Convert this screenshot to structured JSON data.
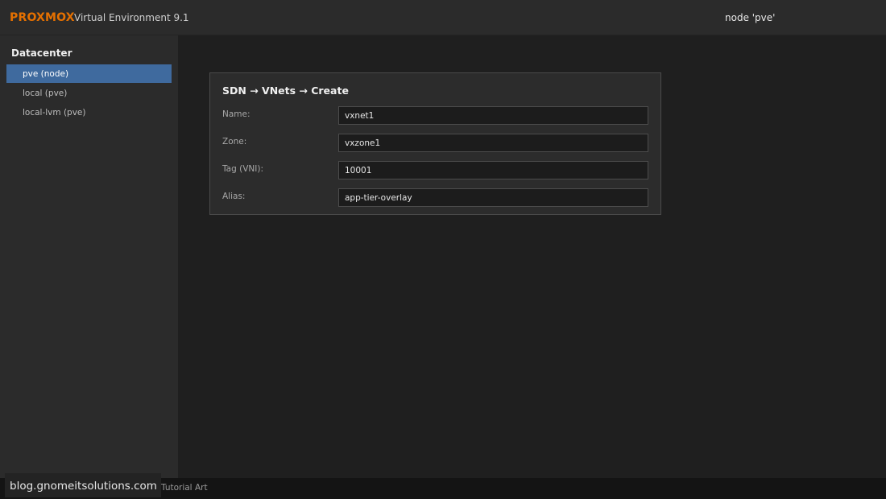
{
  "header": {
    "logo": "PROXMOX",
    "product": "Virtual Environment 9.1",
    "node": "node 'pve'"
  },
  "sidebar": {
    "title": "Datacenter",
    "items": [
      {
        "label": "pve (node)",
        "selected": true
      },
      {
        "label": "local (pve)",
        "selected": false
      },
      {
        "label": "local-lvm (pve)",
        "selected": false
      }
    ]
  },
  "panel": {
    "title": "SDN → VNets → Create",
    "fields": [
      {
        "label": "Name:",
        "value": "vxnet1"
      },
      {
        "label": "Zone:",
        "value": "vxzone1"
      },
      {
        "label": "Tag (VNI):",
        "value": "10001"
      },
      {
        "label": "Alias:",
        "value": "app-tier-overlay"
      }
    ]
  },
  "footer": {
    "text": "Tutorial Art"
  },
  "watermark": {
    "text": "blog.gnomeitsolutions.com"
  },
  "colors": {
    "brand": "#e57000",
    "selection": "#3f6a9e",
    "background": "#1f1f1f"
  }
}
